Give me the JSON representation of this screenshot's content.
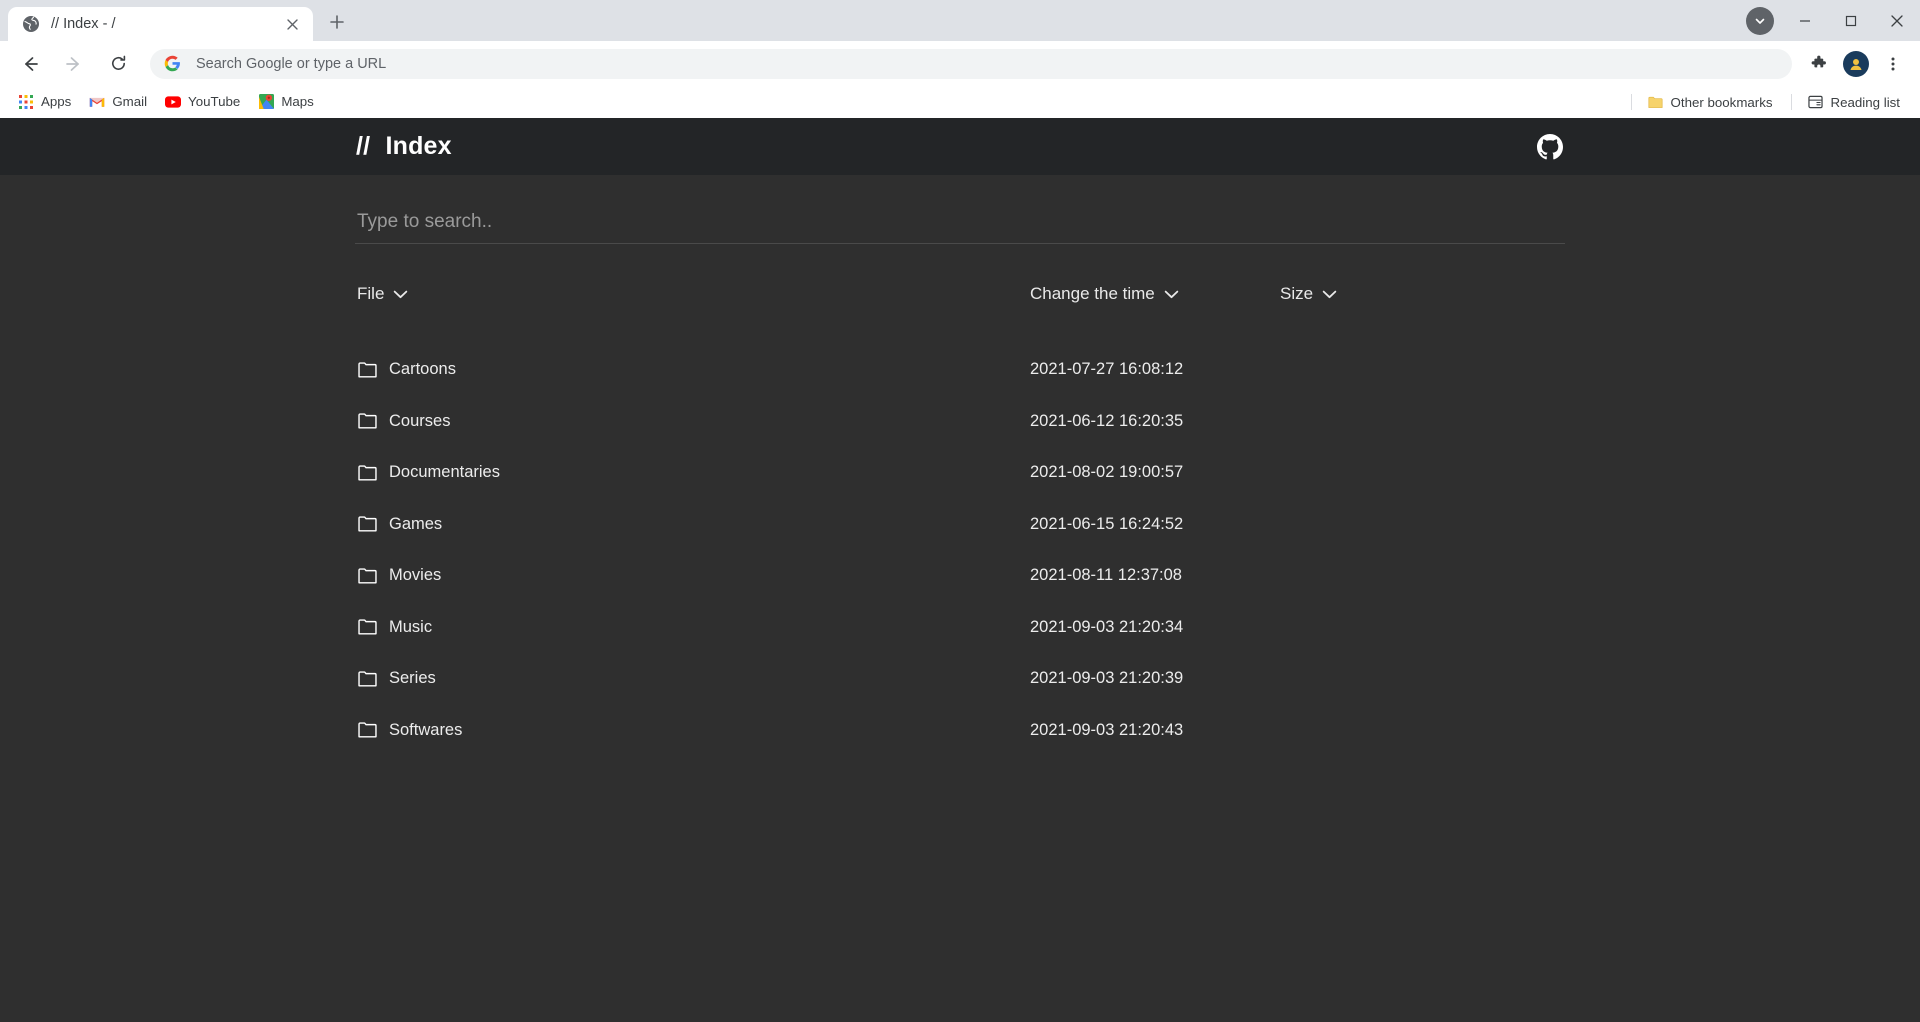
{
  "browser": {
    "tab": {
      "title": "// Index - /",
      "favicon_icon": "globe-icon",
      "close_icon": "close-icon"
    },
    "new_tab_label": "+",
    "window_controls": {
      "extensions_overflow_icon": "chevron-circle-icon",
      "minimize_label": "—",
      "maximize_label": "❐",
      "close_label": "✕"
    },
    "toolbar": {
      "back_icon": "back-arrow-icon",
      "forward_icon": "forward-arrow-icon",
      "reload_icon": "reload-icon",
      "omnibox_placeholder": "Search Google or type a URL",
      "omnibox_value": "",
      "search_engine_icon": "google-g-icon",
      "extensions_icon": "puzzle-piece-icon",
      "profile_icon": "profile-avatar-icon",
      "menu_icon": "three-dot-menu-icon"
    },
    "bookmarks": {
      "items": [
        {
          "label": "Apps",
          "icon": "apps-grid-icon"
        },
        {
          "label": "Gmail",
          "icon": "gmail-icon"
        },
        {
          "label": "YouTube",
          "icon": "youtube-icon"
        },
        {
          "label": "Maps",
          "icon": "maps-icon"
        }
      ],
      "other_bookmarks": {
        "label": "Other bookmarks",
        "icon": "folder-icon"
      },
      "reading_list": {
        "label": "Reading list",
        "icon": "reading-list-icon"
      }
    }
  },
  "page": {
    "header": {
      "brand_prefix": "//",
      "brand_name": "Index",
      "github_icon": "github-icon"
    },
    "search": {
      "placeholder": "Type to search..",
      "value": ""
    },
    "table": {
      "columns": [
        {
          "label": "File",
          "sort_icon": "chevron-down-icon"
        },
        {
          "label": "Change the time",
          "sort_icon": "chevron-down-icon"
        },
        {
          "label": "Size",
          "sort_icon": "chevron-down-icon"
        }
      ],
      "rows": [
        {
          "icon": "folder-icon",
          "name": "Cartoons",
          "time": "2021-07-27 16:08:12",
          "size": ""
        },
        {
          "icon": "folder-icon",
          "name": "Courses",
          "time": "2021-06-12 16:20:35",
          "size": ""
        },
        {
          "icon": "folder-icon",
          "name": "Documentaries",
          "time": "2021-08-02 19:00:57",
          "size": ""
        },
        {
          "icon": "folder-icon",
          "name": "Games",
          "time": "2021-06-15 16:24:52",
          "size": ""
        },
        {
          "icon": "folder-icon",
          "name": "Movies",
          "time": "2021-08-11 12:37:08",
          "size": ""
        },
        {
          "icon": "folder-icon",
          "name": "Music",
          "time": "2021-09-03 21:20:34",
          "size": ""
        },
        {
          "icon": "folder-icon",
          "name": "Series",
          "time": "2021-09-03 21:20:39",
          "size": ""
        },
        {
          "icon": "folder-icon",
          "name": "Softwares",
          "time": "2021-09-03 21:20:43",
          "size": ""
        }
      ]
    },
    "colors": {
      "header_bg": "#232527",
      "page_bg": "#2f2f2f",
      "text": "#ececec",
      "muted": "#9a9a9a",
      "rule": "#4a4a4a"
    }
  }
}
